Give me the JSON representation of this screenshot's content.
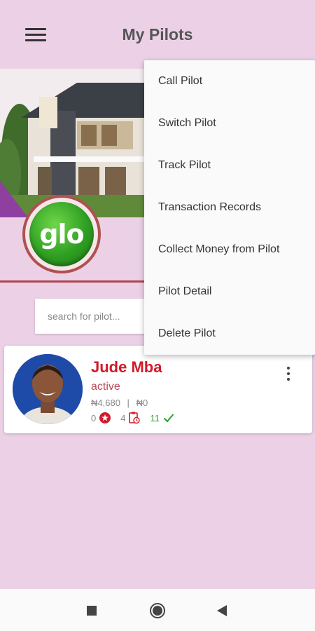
{
  "appbar": {
    "title": "My Pilots",
    "menu_icon": "hamburger-icon"
  },
  "search": {
    "placeholder": "search for pilot..."
  },
  "logo": {
    "text": "glo"
  },
  "pilot": {
    "name": "Jude Mba",
    "status": "active",
    "balance": "₦4,680",
    "separator": "|",
    "owed": "₦0",
    "rating_count": "0",
    "pending_count": "4",
    "completed_count": "11"
  },
  "context_menu": {
    "items": [
      {
        "label": "Call Pilot"
      },
      {
        "label": "Switch Pilot"
      },
      {
        "label": "Track Pilot"
      },
      {
        "label": "Transaction Records"
      },
      {
        "label": "Collect Money from Pilot"
      },
      {
        "label": "Pilot Detail"
      },
      {
        "label": "Delete Pilot"
      }
    ]
  },
  "colors": {
    "background": "#ecd1e6",
    "accent_red": "#d11a2a",
    "status_red": "#c14a57",
    "green": "#2aa02a",
    "glo_green": "#2f9f22"
  },
  "navbar": {
    "icons": [
      "recents-square-icon",
      "home-circle-icon",
      "back-triangle-icon"
    ]
  }
}
